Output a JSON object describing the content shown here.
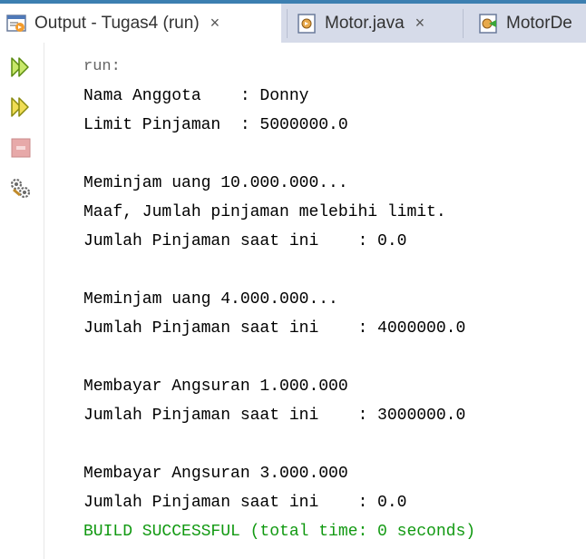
{
  "tabs": [
    {
      "label": "Output - Tugas4 (run)",
      "close": "×",
      "icon": "output-icon",
      "active": true
    },
    {
      "label": "Motor.java",
      "close": "×",
      "icon": "java-file-icon",
      "active": false
    },
    {
      "label": "MotorDe",
      "close": "",
      "icon": "java-main-file-icon",
      "active": false
    }
  ],
  "toolbar": {
    "buttons": [
      "rerun-icon",
      "rerun-with-options-icon",
      "stop-icon",
      "settings-icon"
    ]
  },
  "output": {
    "lines": [
      "run:",
      "Nama Anggota    : Donny",
      "Limit Pinjaman  : 5000000.0",
      "",
      "Meminjam uang 10.000.000...",
      "Maaf, Jumlah pinjaman melebihi limit.",
      "Jumlah Pinjaman saat ini    : 0.0",
      "",
      "Meminjam uang 4.000.000...",
      "Jumlah Pinjaman saat ini    : 4000000.0",
      "",
      "Membayar Angsuran 1.000.000",
      "Jumlah Pinjaman saat ini    : 3000000.0",
      "",
      "Membayar Angsuran 3.000.000",
      "Jumlah Pinjaman saat ini    : 0.0",
      "BUILD SUCCESSFUL (total time: 0 seconds)"
    ]
  },
  "colors": {
    "success": "#119911",
    "tab_bar": "#d6dbe9",
    "tab_accent": "#3c7fb1"
  }
}
